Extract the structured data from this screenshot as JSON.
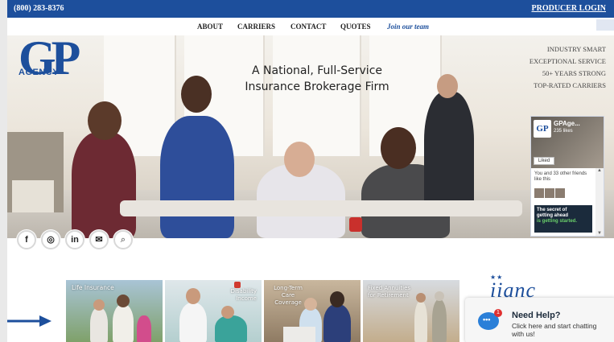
{
  "topbar": {
    "phone": "(800) 283-8376",
    "producer_login": "PRODUCER LOGIN"
  },
  "nav": {
    "items": [
      "ABOUT",
      "CARRIERS",
      "CONTACT",
      "QUOTES"
    ],
    "join": "Join our team"
  },
  "logo": {
    "mark": "GP",
    "text": "AGENCY"
  },
  "hero": {
    "headline_line1": "A National, Full-Service",
    "headline_line2": "Insurance Brokerage Firm",
    "taglines": [
      "INDUSTRY SMART",
      "EXCEPTIONAL SERVICE",
      "50+ YEARS STRONG",
      "TOP-RATED CARRIERS"
    ]
  },
  "facebook": {
    "page_name": "GPAge...",
    "likes": "235 likes",
    "liked_label": "Liked",
    "friends_text": "You and 33 other friends like this",
    "post_line1": "The secret of",
    "post_line2": "getting ahead",
    "post_line3": "is getting started."
  },
  "social": {
    "icons": [
      "facebook-icon",
      "instagram-icon",
      "linkedin-icon",
      "email-icon",
      "search-icon"
    ],
    "labels": [
      "f",
      "◎",
      "in",
      "✉",
      "⌕"
    ]
  },
  "tiles": [
    {
      "label": "Life Insurance"
    },
    {
      "label_line1": "Disability",
      "label_line2": "Income"
    },
    {
      "label_line1": "Long-Term",
      "label_line2": "Care",
      "label_line3": "Coverage"
    },
    {
      "label_line1": "Fixed Annuities",
      "label_line2": "for Retirement"
    }
  ],
  "association": {
    "logo_text": "iianc",
    "stars": "★★"
  },
  "chat": {
    "title": "Need Help?",
    "subtitle": "Click here and start chatting with us!",
    "badge": "1"
  },
  "colors": {
    "brand_blue": "#1d4f9c",
    "chat_blue": "#2a7fd8"
  }
}
